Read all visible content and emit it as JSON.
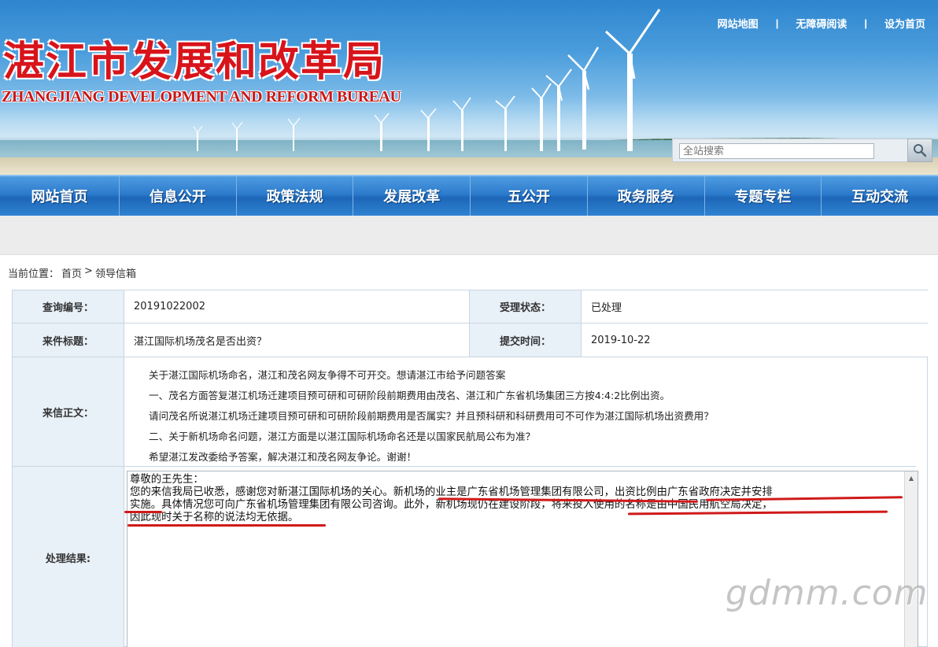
{
  "site": {
    "title_cn": "湛江市发展和改革局",
    "title_en": "ZHANGJIANG DEVELOPMENT AND REFORM BUREAU"
  },
  "top_links": {
    "sitemap": "网站地图",
    "separator": "|",
    "accessibility": "无障碍阅读",
    "set_home": "设为首页"
  },
  "search": {
    "placeholder": "全站搜索",
    "icon": "search-icon"
  },
  "nav": {
    "items": [
      "网站首页",
      "信息公开",
      "政策法规",
      "发展改革",
      "五公开",
      "政务服务",
      "专题专栏",
      "互动交流"
    ]
  },
  "breadcrumb": {
    "prefix": "当前位置：",
    "home": "首页",
    "separator": ">",
    "current": "领导信箱"
  },
  "detail": {
    "query_no_label": "查询编号：",
    "query_no": "20191022002",
    "status_label": "受理状态：",
    "status": "已处理",
    "subject_label": "来件标题：",
    "subject": "湛江国际机场茂名是否出资？",
    "submit_time_label": "提交时间：",
    "submit_time": "2019-10-22",
    "body_label": "来信正文：",
    "body_lines": [
      "关于湛江国际机场命名，湛江和茂名网友争得不可开交。想请湛江市给予问题答案",
      "一、茂名方面答复湛江机场迁建项目预可研和可研阶段前期费用由茂名、湛江和广东省机场集团三方按4:4:2比例出资。",
      "请问茂名所说湛江机场迁建项目预可研和可研阶段前期费用是否属实？并且预科研和科研费用可不可作为湛江国际机场出资费用？",
      "二、关于新机场命名问题，湛江方面是以湛江国际机场命名还是以国家民航局公布为准？",
      "希望湛江发改委给予答案，解决湛江和茂名网友争论。谢谢！"
    ],
    "result_label": "处理结果:",
    "reply_lines": [
      "尊敬的王先生：",
      "您的来信我局已收悉，感谢您对新湛江国际机场的关心。新机场的业主是广东省机场管理集团有限公司，出资比例由广东省政府决定并安排",
      "实施。具体情况您可向广东省机场管理集团有限公司咨询。此外，新机场现仍在建设阶段，将来投入使用的名称是由中国民用航空局决定，",
      "因此现时关于名称的说法均无依据。"
    ]
  },
  "colors": {
    "title_red": "#d8141b",
    "nav_blue": "#2c7bcc",
    "label_bg": "#e8f0f8",
    "underline_red": "#d01a1a"
  },
  "watermark": "gdmm.com"
}
